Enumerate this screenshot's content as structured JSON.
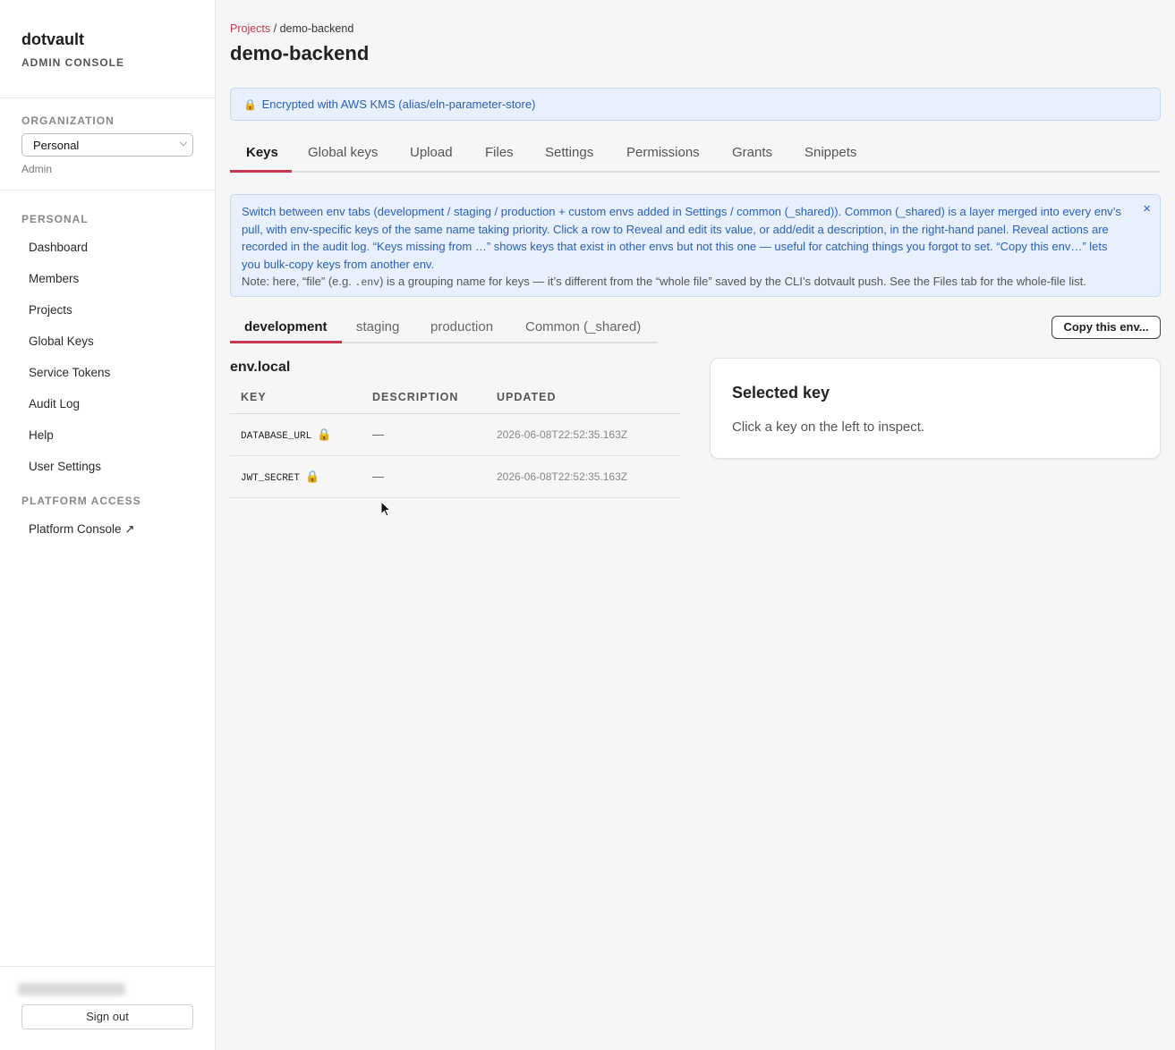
{
  "brand": {
    "name": "dotvault",
    "subtitle": "ADMIN CONSOLE"
  },
  "organization": {
    "label": "ORGANIZATION",
    "selected": "Personal",
    "role": "Admin"
  },
  "sidebar": {
    "personal_label": "PERSONAL",
    "items": [
      {
        "label": "Dashboard"
      },
      {
        "label": "Members"
      },
      {
        "label": "Projects"
      },
      {
        "label": "Global Keys"
      },
      {
        "label": "Service Tokens"
      },
      {
        "label": "Audit Log"
      },
      {
        "label": "Help"
      },
      {
        "label": "User Settings"
      }
    ],
    "platform_label": "PLATFORM ACCESS",
    "platform_item": "Platform Console ↗",
    "sign_out": "Sign out"
  },
  "breadcrumb": {
    "root": "Projects",
    "sep": " / ",
    "current": "demo-backend"
  },
  "page_title": "demo-backend",
  "kms_banner": "Encrypted with AWS KMS (alias/eln-parameter-store)",
  "tabs": [
    "Keys",
    "Global keys",
    "Upload",
    "Files",
    "Settings",
    "Permissions",
    "Grants",
    "Snippets"
  ],
  "help": {
    "main": "Switch between env tabs (development / staging / production + custom envs added in Settings / common (_shared)). Common (_shared) is a layer merged into every env’s pull, with env-specific keys of the same name taking priority. Click a row to Reveal and edit its value, or add/edit a description, in the right-hand panel. Reveal actions are recorded in the audit log. “Keys missing from …” shows keys that exist in other envs but not this one — useful for catching things you forgot to set. “Copy this env…” lets you bulk-copy keys from another env.",
    "note_pre": "Note: here, “file” (e.g. ",
    "note_code": ".env",
    "note_post": ") is a grouping name for keys — it’s different from the “whole file” saved by the CLI’s dotvault push. See the Files tab for the whole-file list.",
    "close": "×"
  },
  "env_tabs": [
    "development",
    "staging",
    "production",
    "Common (_shared)"
  ],
  "copy_env": "Copy this env...",
  "file": {
    "title": "env.local",
    "headers": [
      "KEY",
      "DESCRIPTION",
      "UPDATED"
    ],
    "rows": [
      {
        "key": "DATABASE_URL",
        "description": "—",
        "updated": "2026-06-08T22:52:35.163Z"
      },
      {
        "key": "JWT_SECRET",
        "description": "—",
        "updated": "2026-06-08T22:52:35.163Z"
      }
    ]
  },
  "selected_panel": {
    "title": "Selected key",
    "hint": "Click a key on the left to inspect."
  },
  "colors": {
    "accent": "#c8374f",
    "info_bg": "#e8f0fd",
    "info_text": "#2a5fb8"
  }
}
